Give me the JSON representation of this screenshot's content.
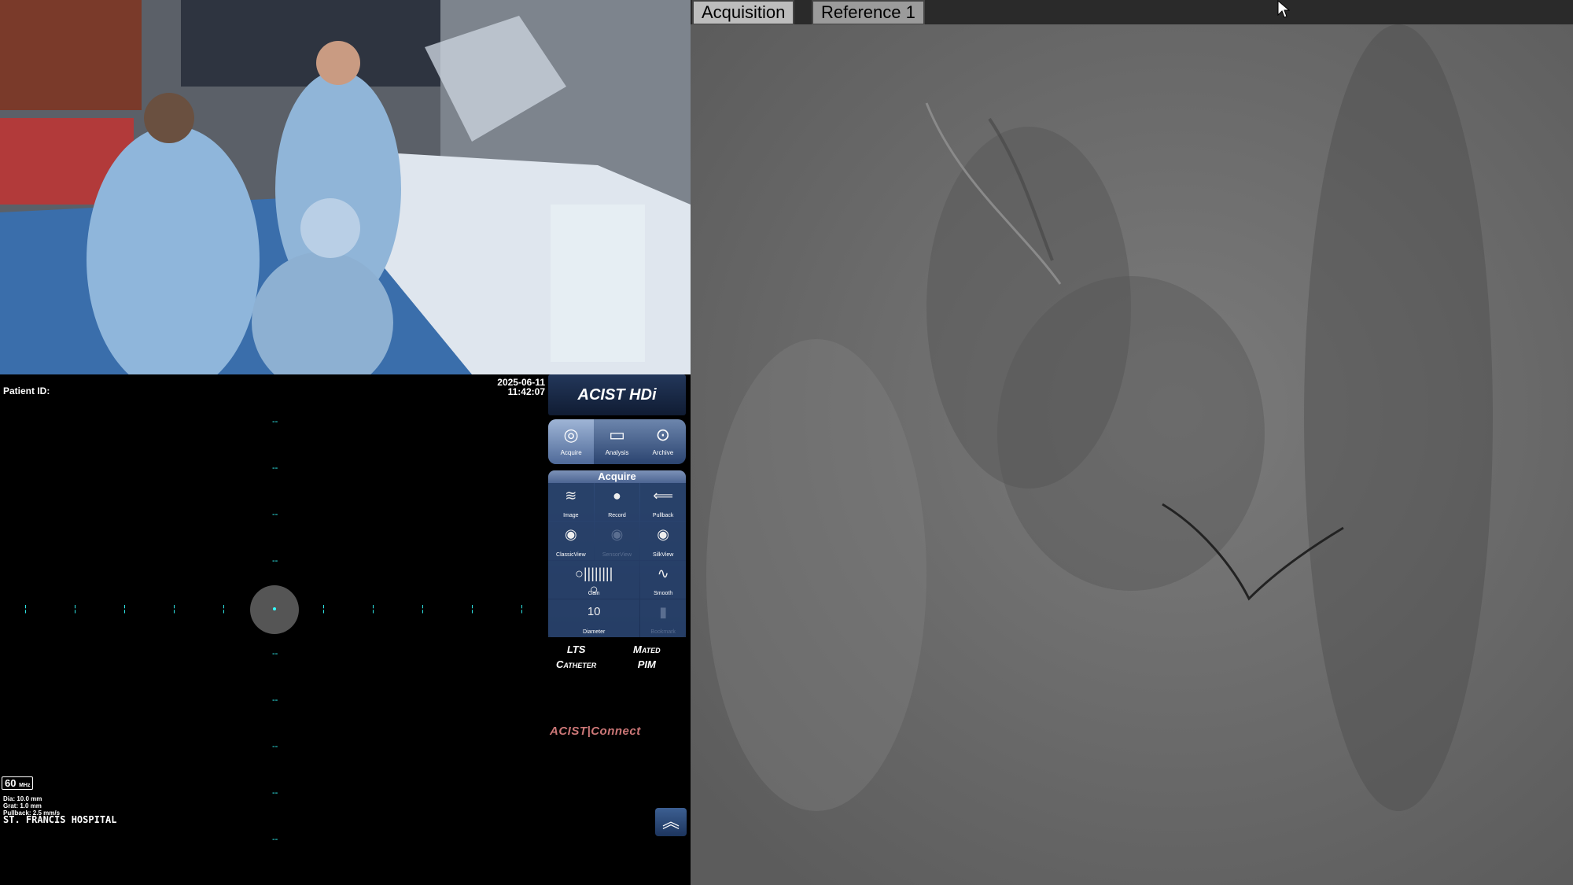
{
  "ivus": {
    "patient_label": "Patient ID:",
    "date": "2025-06-11",
    "time": "11:42:07",
    "frequency": "60",
    "frequency_unit": "MHz",
    "dia": "Dia: 10.0 mm",
    "grat": "Grat: 1.0 mm",
    "pullback": "Pullback: 2.5 mm/s",
    "hospital": "ST. FRANCIS HOSPITAL"
  },
  "controls": {
    "logo": "ACIST HDi",
    "modes": [
      {
        "label": "Acquire",
        "icon": "target-icon"
      },
      {
        "label": "Analysis",
        "icon": "ruler-icon"
      },
      {
        "label": "Archive",
        "icon": "disc-icon"
      }
    ],
    "acquire_header": "Acquire",
    "buttons": {
      "image": "Image",
      "record": "Record",
      "pullback": "Pullback",
      "classicview": "ClassicView",
      "sensorview": "SensorView",
      "silkview": "SilkView",
      "gain": "Gain",
      "smooth": "Smooth",
      "diameter": "Diameter",
      "diameter_value": "10",
      "bookmark": "Bookmark"
    },
    "catheter": [
      "LTS",
      "Catheter"
    ],
    "pim": [
      "Mated",
      "PIM"
    ],
    "connect": "ACIST|Connect"
  },
  "angio": {
    "tabs": [
      "Acquisition",
      "Reference 1"
    ],
    "active_tab": 0
  }
}
